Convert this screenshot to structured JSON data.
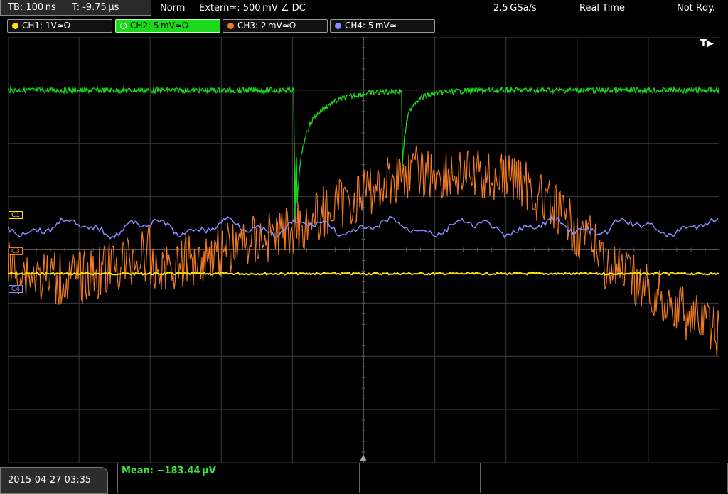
{
  "status_bar": {
    "timebase": "TB: 100 ns",
    "trigger_time": "T: -9.75 µs",
    "mode": "Norm",
    "trigger_source": "Extern≃: 500 mV ∠ DC",
    "sample_rate": "2.5 GSa/s",
    "acquisition": "Real Time",
    "state": "Not Rdy."
  },
  "channels": [
    {
      "label": "CH1: 1V≃Ω",
      "color": "#ffe600",
      "active": false
    },
    {
      "label": "CH2: 5 mV≃Ω",
      "color": "#1bd81b",
      "active": true
    },
    {
      "label": "CH3: 2 mV≃Ω",
      "color": "#f07a20",
      "active": false
    },
    {
      "label": "CH4: 5 mV≃",
      "color": "#8a8aff",
      "active": false
    }
  ],
  "markers": {
    "ch1": "C1",
    "ch3": "C3",
    "ch4": "C4",
    "trigger": "T▶"
  },
  "measurement": {
    "mean": "Mean: −183.44 µV"
  },
  "datetime": "2015-04-27  03:35",
  "colors": {
    "ch1": "#ffe600",
    "ch2": "#1bd81b",
    "ch3": "#f07a20",
    "ch4": "#8a8aff",
    "grid": "#3a3a3a"
  }
}
